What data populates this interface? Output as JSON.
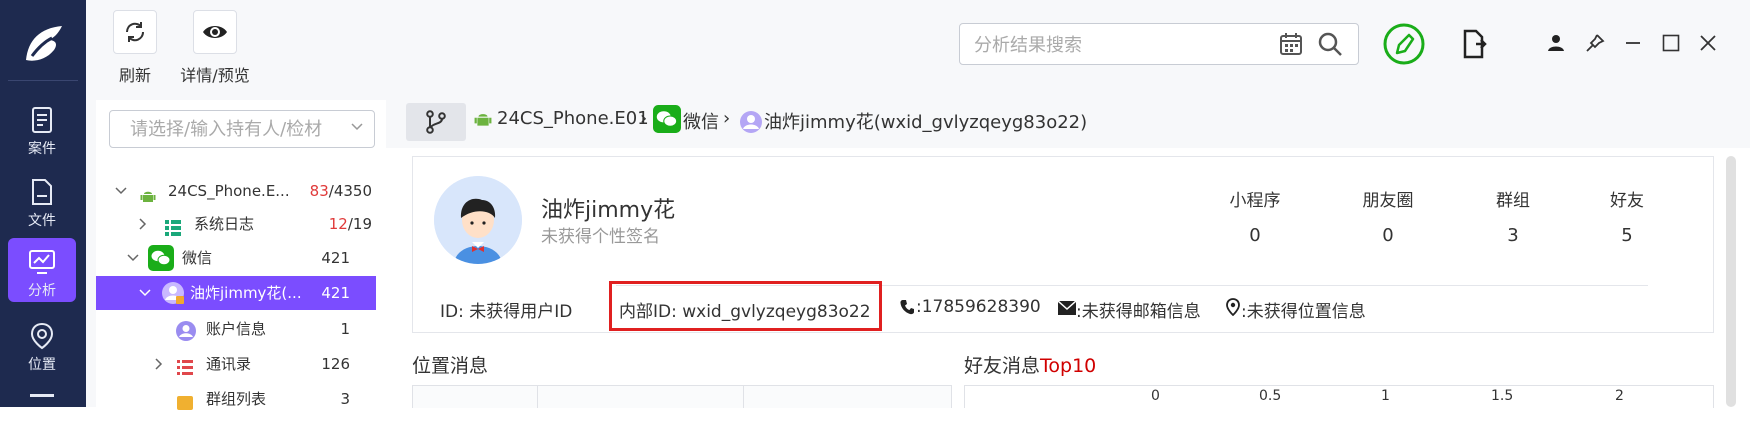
{
  "toolbar": {
    "refresh_label": "刷新",
    "details_label": "详情/预览",
    "search_placeholder": "分析结果搜索"
  },
  "nav": {
    "items": [
      {
        "label": "案件",
        "icon": "case-icon"
      },
      {
        "label": "文件",
        "icon": "file-icon"
      },
      {
        "label": "分析",
        "icon": "analysis-icon",
        "active": true
      },
      {
        "label": "位置",
        "icon": "location-icon"
      }
    ]
  },
  "tree": {
    "placeholder": "请选择/输入持有人/检材",
    "rows": [
      {
        "label": "24CS_Phone.E...",
        "count_red": "83",
        "count_rest": "/4350",
        "icon": "android-icon"
      },
      {
        "label": "系统日志",
        "count_red": "12",
        "count_rest": "/19",
        "icon": "log-icon"
      },
      {
        "label": "微信",
        "count": "421",
        "icon": "wechat-icon"
      },
      {
        "label": "油炸jimmy花(...",
        "count": "421",
        "icon": "user-icon",
        "selected": true
      },
      {
        "label": "账户信息",
        "count": "1",
        "icon": "user-icon"
      },
      {
        "label": "通讯录",
        "count": "126",
        "icon": "contacts-icon"
      },
      {
        "label": "群组列表",
        "count": "3",
        "icon": "group-icon"
      }
    ]
  },
  "breadcrumb": {
    "device": "24CS_Phone.E01",
    "app": "微信",
    "account": "油炸jimmy花(wxid_gvlyzqeyg83o22)"
  },
  "profile": {
    "name": "油炸jimmy花",
    "signature": "未获得个性签名",
    "stats": [
      {
        "label": "小程序",
        "value": "0"
      },
      {
        "label": "朋友圈",
        "value": "0"
      },
      {
        "label": "群组",
        "value": "3"
      },
      {
        "label": "好友",
        "value": "5"
      }
    ],
    "id_text": "ID: 未获得用户ID",
    "internal_id_text": "内部ID: wxid_gvlyzqeyg83o22",
    "phone_text": ":17859628390",
    "email_text": ":未获得邮箱信息",
    "location_text": ":未获得位置信息"
  },
  "sections": {
    "location_title": "位置消息",
    "friends_title_prefix": "好友消息",
    "friends_title_suffix": "Top10",
    "friends_axis_ticks": [
      "0",
      "0.5",
      "1",
      "1.5",
      "2"
    ]
  },
  "colors": {
    "rail": "#1e2a4f",
    "accent": "#7b4dff",
    "highlight_border": "#e02020",
    "wechat_green": "#1aad19",
    "red_count": "#e03a3a"
  }
}
